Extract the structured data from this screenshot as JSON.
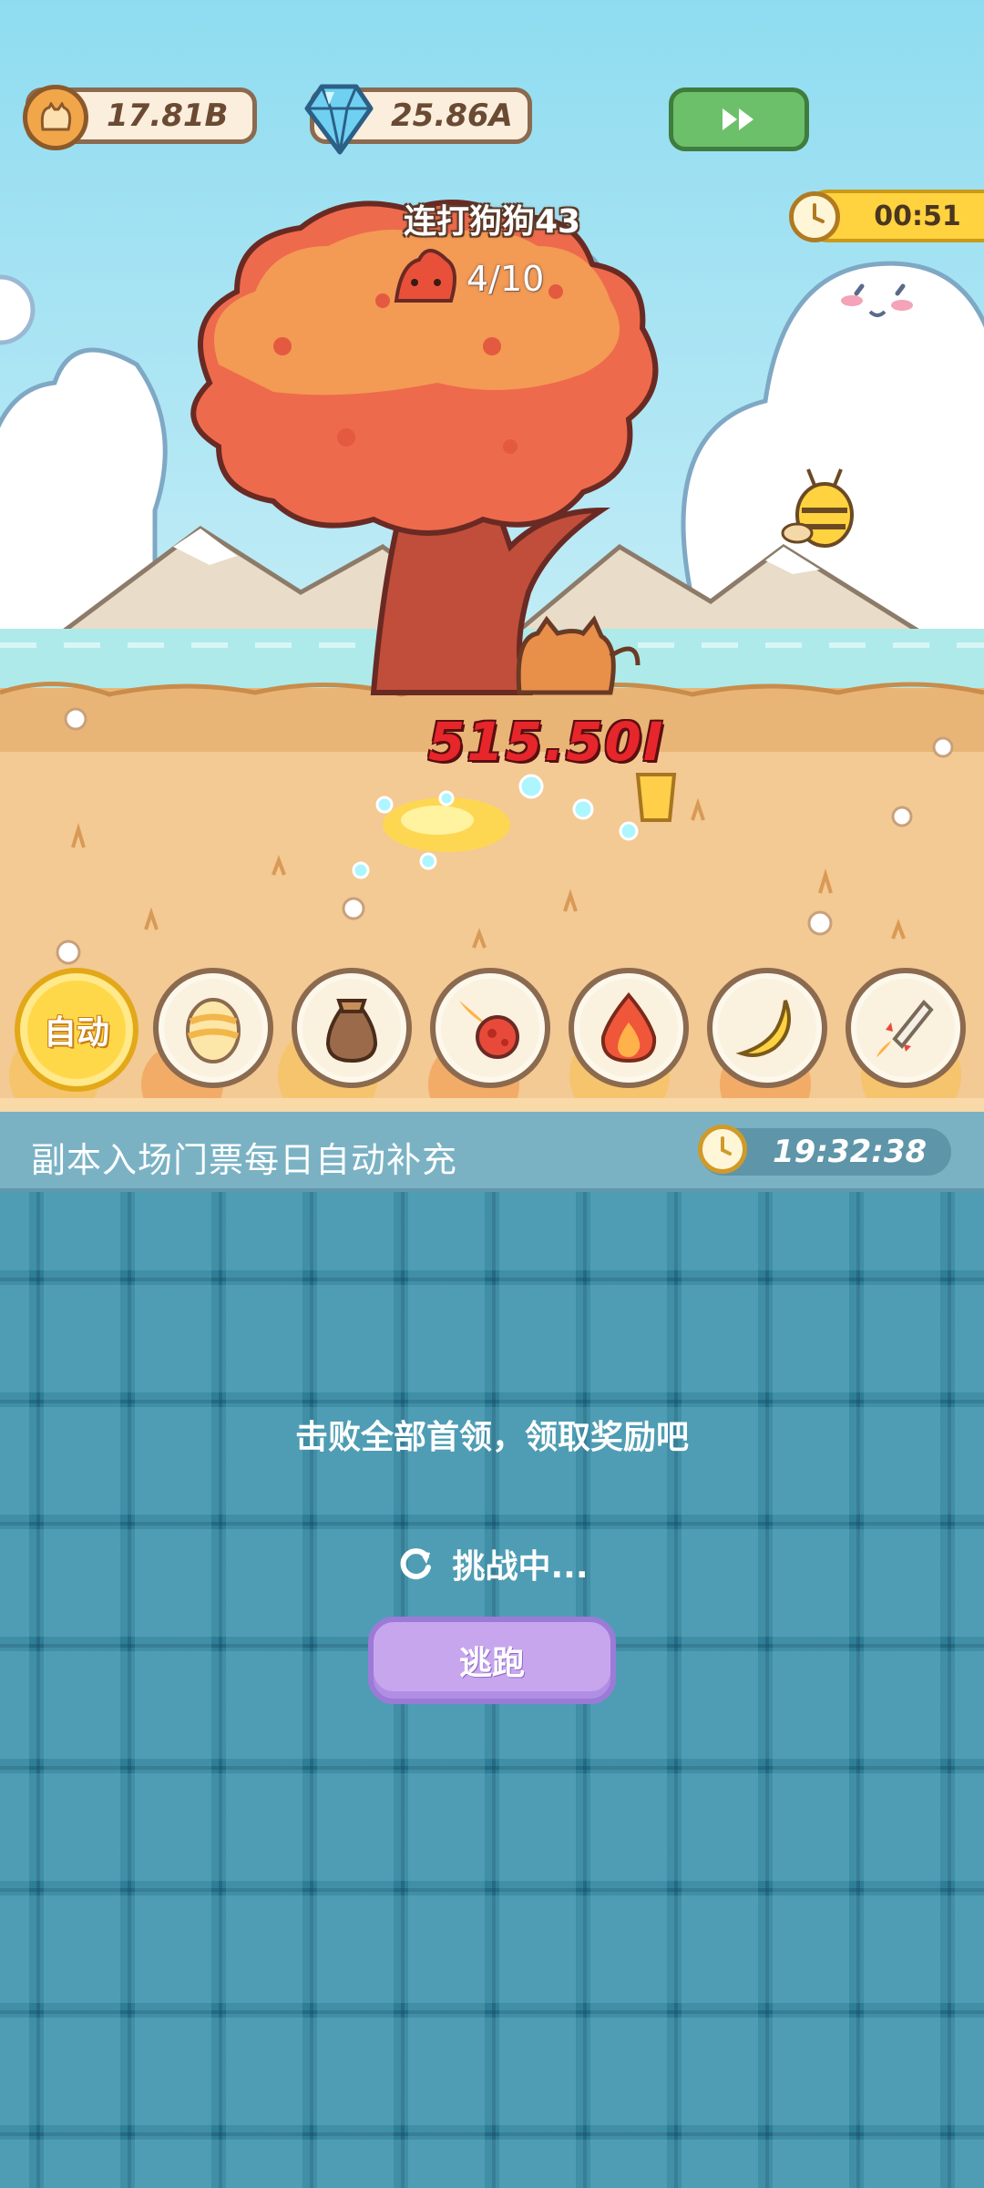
{
  "hud": {
    "coins": "17.81B",
    "gems": "25.86A",
    "fast_forward_icon": "fast-forward-icon"
  },
  "boss": {
    "title": "连打狗狗43",
    "progress": "4/10"
  },
  "battle_timer": "00:51",
  "damage_popup": "515.50I",
  "skills": {
    "auto_label": "自动",
    "icons": [
      "egg-icon",
      "sack-icon",
      "meteor-icon",
      "fire-icon",
      "banana-icon",
      "rocket-icon"
    ]
  },
  "notice": {
    "text": "副本入场门票每日自动补充",
    "countdown": "19:32:38"
  },
  "panel": {
    "message": "击败全部首领，领取奖励吧",
    "status": "挑战中...",
    "flee_label": "逃跑"
  },
  "colors": {
    "sky": "#8fdcf0",
    "ground": "#f2c98f",
    "panel": "#2e7e98",
    "damage": "#e7262b",
    "flee_button": "#c7a6ee"
  }
}
